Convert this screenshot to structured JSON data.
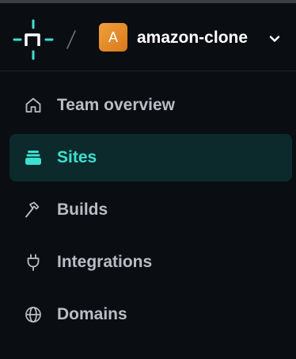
{
  "header": {
    "logo_icon": "netlify-logo-icon",
    "separator": "/",
    "team_initial": "A",
    "team_name": "amazon-clone",
    "switch_icon": "chevron-down-icon"
  },
  "colors": {
    "background": "#0a0e12",
    "accent": "#3ce0cf",
    "active_bg": "#0c2a2c",
    "team_badge": "#e8902a",
    "muted_text": "#b9bec5"
  },
  "nav": {
    "items": [
      {
        "label": "Team overview",
        "icon": "home-icon",
        "active": false
      },
      {
        "label": "Sites",
        "icon": "sites-stack-icon",
        "active": true
      },
      {
        "label": "Builds",
        "icon": "hammer-icon",
        "active": false
      },
      {
        "label": "Integrations",
        "icon": "plug-icon",
        "active": false
      },
      {
        "label": "Domains",
        "icon": "globe-icon",
        "active": false
      }
    ]
  }
}
